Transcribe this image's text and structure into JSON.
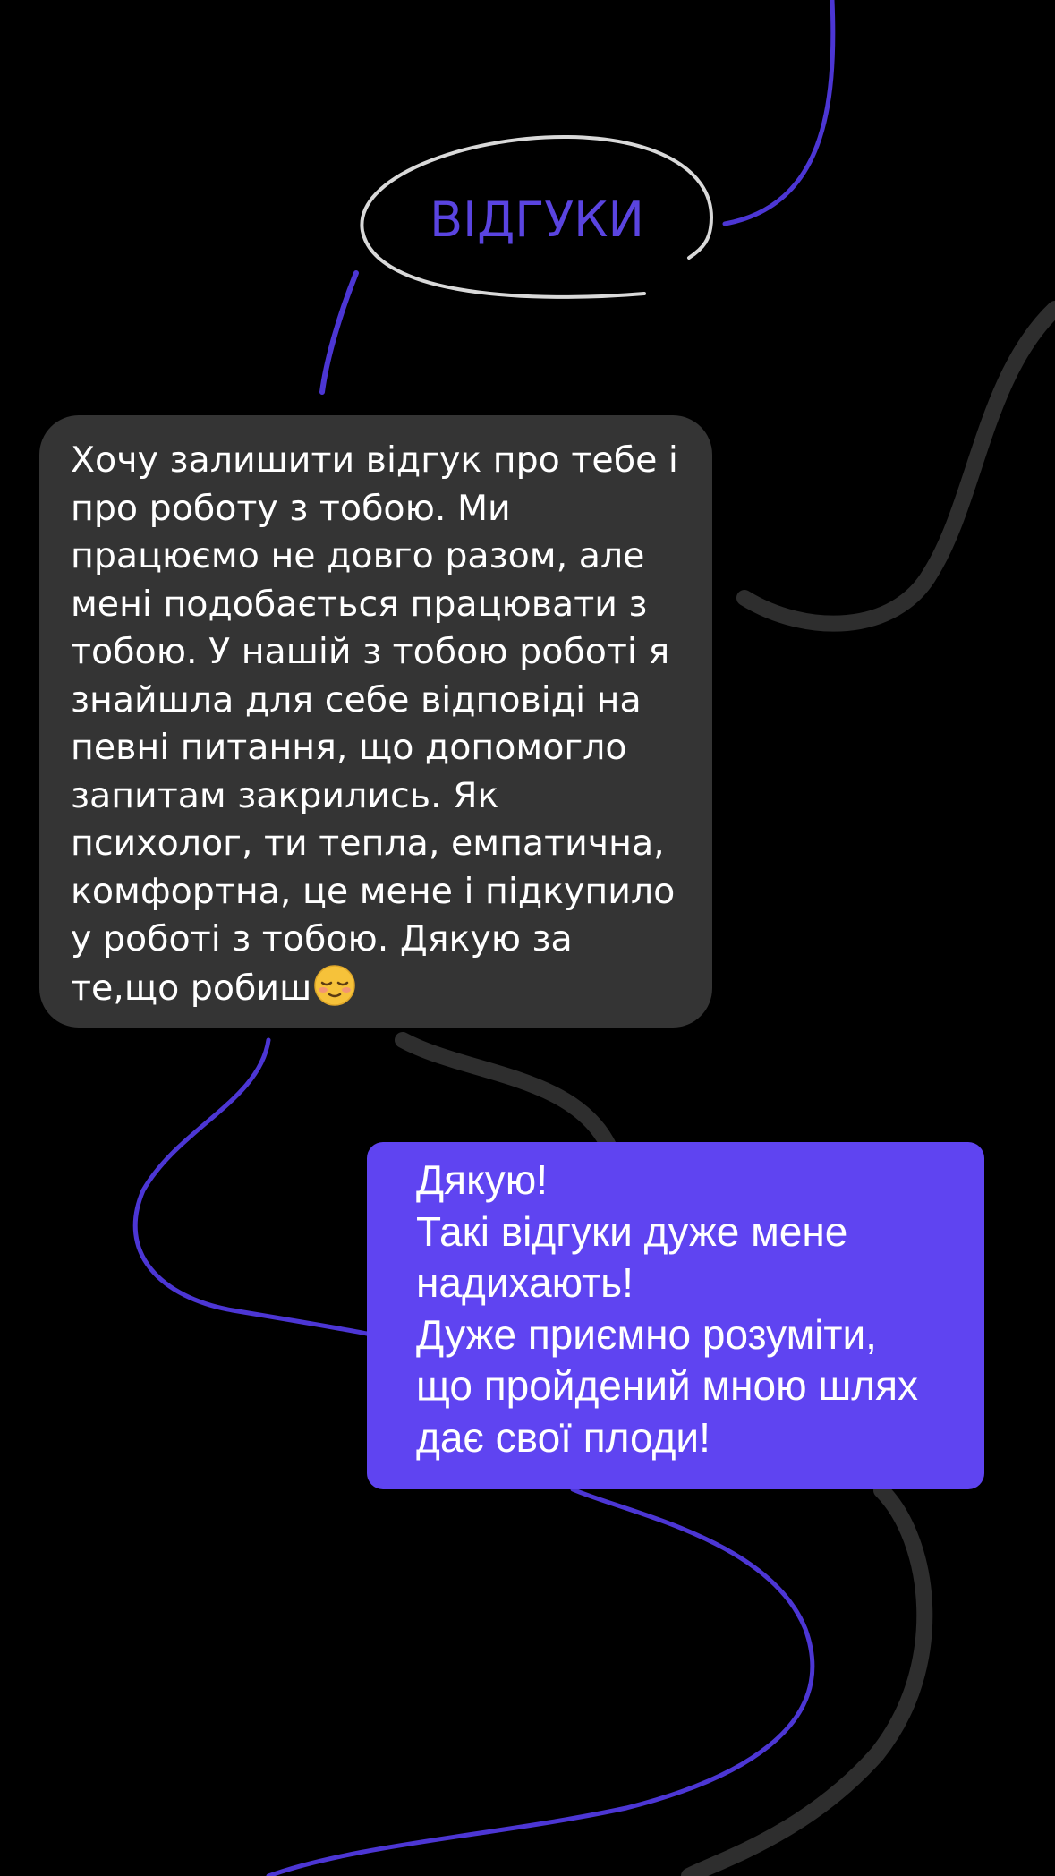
{
  "page": {
    "background": "#000000"
  },
  "colors": {
    "accent": "#5f44f1",
    "title": "#5a44e0",
    "line_purple": "#4c36d4",
    "line_gray": "#2e2e2e",
    "bubble_gray": "#343434",
    "oval": "#d9d9d9"
  },
  "header": {
    "title": "ВІДГУКИ"
  },
  "review": {
    "text": "Хочу залишити відгук про тебе і\nпро роботу з тобою. Ми\nпрацюємо не довго разом, але\nмені подобається працювати з\nтобою. У нашій з тобою роботі я\nзнайшла для себе відповіді на\nпевні питання, що допомогло\nзапитам закрились. Як\nпсихолог, ти тепла, емпатична,\nкомфортна, це мене і підкупило\nу роботі з тобою. Дякую за\nте,що робиш",
    "emoji": "relieved-face-emoji"
  },
  "reply": {
    "text": "Дякую!\nТакі відгуки дуже мене\nнадихають!\nДуже приємно розуміти,\nщо пройдений мною шлях\nдає свої плоди!"
  }
}
